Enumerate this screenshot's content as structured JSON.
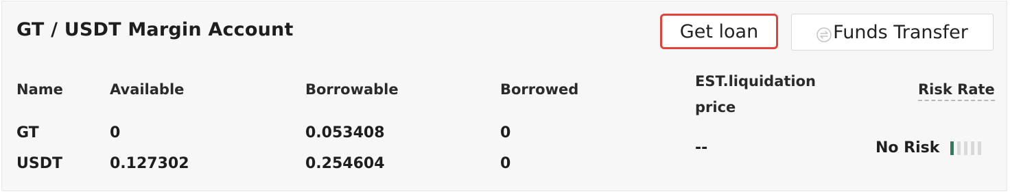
{
  "account": {
    "title": "GT / USDT Margin Account"
  },
  "buttons": {
    "get_loan": "Get loan",
    "funds_transfer": "Funds Transfer",
    "funds_transfer_icon": "swap-icon"
  },
  "table": {
    "headers": {
      "name": "Name",
      "available": "Available",
      "borrowable": "Borrowable",
      "borrowed": "Borrowed",
      "est_liquidation_price": "EST.liquidation price",
      "risk_rate": "Risk Rate"
    },
    "rows": [
      {
        "name": "GT",
        "available": "0",
        "borrowable": "0.053408",
        "borrowed": "0"
      },
      {
        "name": "USDT",
        "available": "0.127302",
        "borrowable": "0.254604",
        "borrowed": "0"
      }
    ],
    "est_liquidation_price": "--",
    "risk_rate": {
      "label": "No Risk",
      "level": 1,
      "levels_total": 5,
      "active_color": "#2e7d5b",
      "inactive_color": "#d9d9d9"
    }
  },
  "colors": {
    "highlight_border": "#e1433a",
    "panel_background": "#f7f7f7"
  }
}
